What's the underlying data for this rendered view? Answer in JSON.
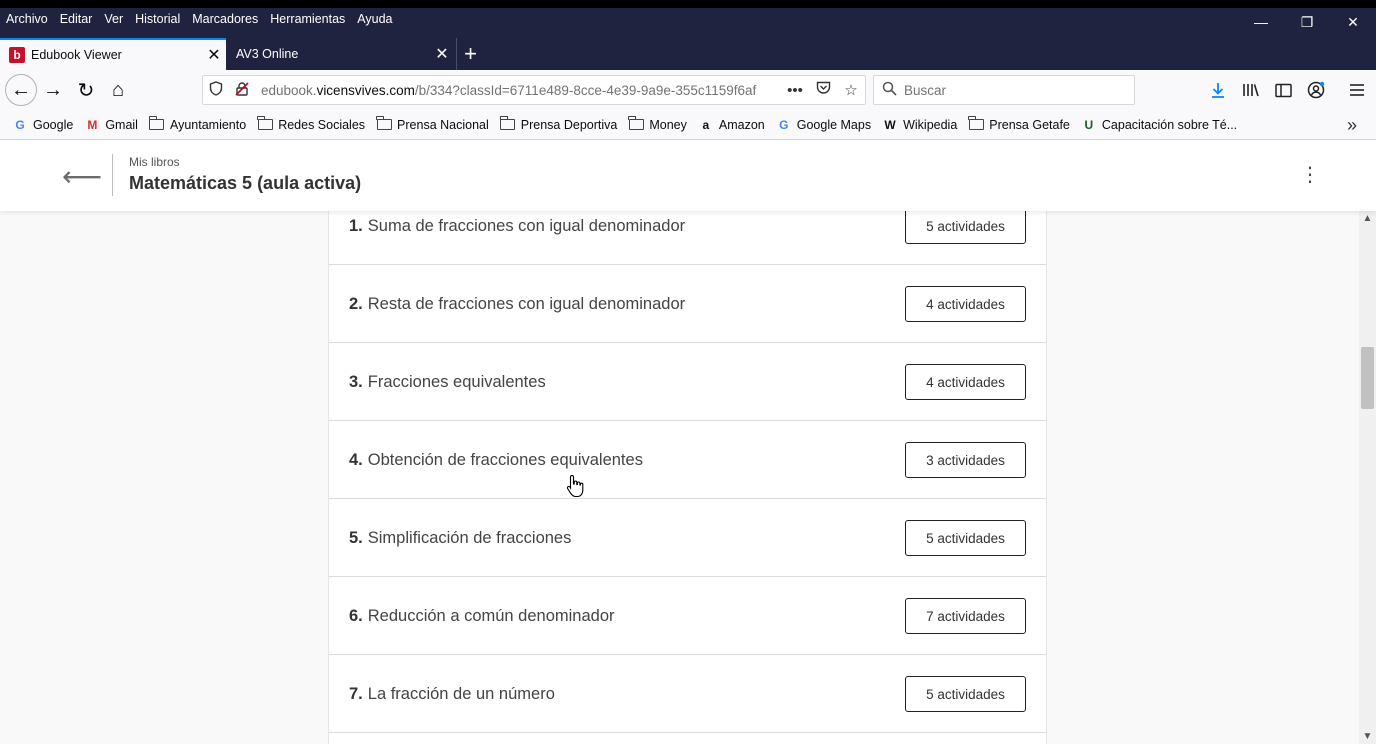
{
  "menu": {
    "items": [
      "Archivo",
      "Editar",
      "Ver",
      "Historial",
      "Marcadores",
      "Herramientas",
      "Ayuda"
    ]
  },
  "window_controls": {
    "minimize": "—",
    "restore": "❐",
    "close": "✕"
  },
  "tabs": [
    {
      "favicon": "b",
      "label": "Edubook Viewer",
      "close": "✕"
    },
    {
      "label": "AV3 Online",
      "close": "✕"
    }
  ],
  "new_tab": "+",
  "nav": {
    "back": "←",
    "forward": "→",
    "reload": "↻",
    "home": "⌂"
  },
  "urlbar": {
    "prefix": "edubook.",
    "domain": "vicensvives.com",
    "path": "/b/334?classId=6711e489-8cce-4e39-9a9e-355c1159f6af",
    "more": "•••"
  },
  "search": {
    "placeholder": "Buscar"
  },
  "bookmarks": [
    {
      "icon": "G",
      "label": "Google",
      "color": "#4285f4"
    },
    {
      "icon": "M",
      "label": "Gmail",
      "color": "#d93025"
    },
    {
      "icon": "folder",
      "label": "Ayuntamiento"
    },
    {
      "icon": "folder",
      "label": "Redes Sociales"
    },
    {
      "icon": "folder",
      "label": "Prensa Nacional"
    },
    {
      "icon": "folder",
      "label": "Prensa Deportiva"
    },
    {
      "icon": "folder",
      "label": "Money"
    },
    {
      "icon": "a",
      "label": "Amazon",
      "color": "#111111"
    },
    {
      "icon": "G",
      "label": "Google Maps",
      "color": "#4285f4"
    },
    {
      "icon": "W",
      "label": "Wikipedia",
      "color": "#111111"
    },
    {
      "icon": "folder",
      "label": "Prensa Getafe"
    },
    {
      "icon": "U",
      "label": "Capacitación sobre Té...",
      "color": "#1a5c2a"
    }
  ],
  "header": {
    "back_arrow": "⟵",
    "breadcrumb": "Mis libros",
    "title": "Matemáticas 5 (aula activa)",
    "menu": "⋮"
  },
  "lessons": [
    {
      "num": "1.",
      "title": "Suma de fracciones con igual denominador",
      "button": "5 actividades"
    },
    {
      "num": "2.",
      "title": "Resta de fracciones con igual denominador",
      "button": "4 actividades"
    },
    {
      "num": "3.",
      "title": "Fracciones equivalentes",
      "button": "4 actividades"
    },
    {
      "num": "4.",
      "title": "Obtención de fracciones equivalentes",
      "button": "3 actividades"
    },
    {
      "num": "5.",
      "title": "Simplificación de fracciones",
      "button": "5 actividades"
    },
    {
      "num": "6.",
      "title": "Reducción a común denominador",
      "button": "7 actividades"
    },
    {
      "num": "7.",
      "title": "La fracción de un número",
      "button": "5 actividades"
    }
  ],
  "colors": {
    "titlebar": "#202340",
    "accent": "#0a84ff",
    "favicon": "#c8102e"
  }
}
